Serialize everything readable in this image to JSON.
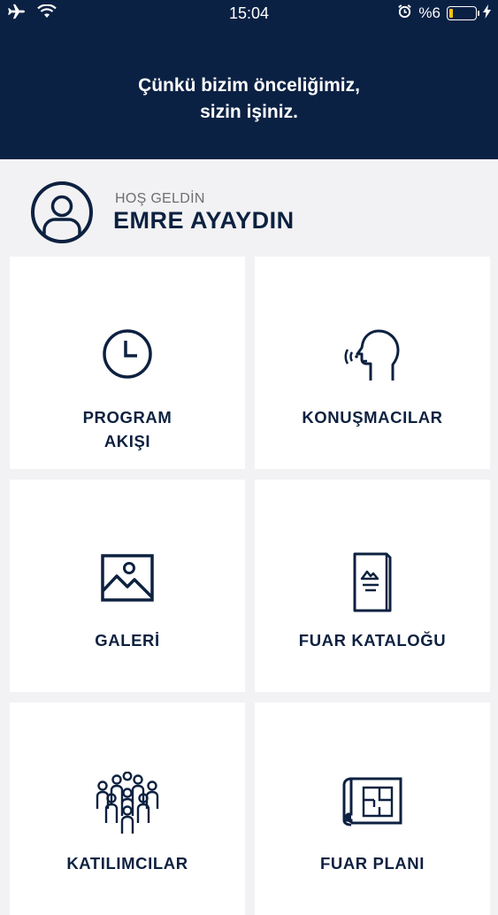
{
  "status_bar": {
    "time": "15:04",
    "battery_text": "%6",
    "battery_level": 0.06,
    "battery_color": "#f1c40f"
  },
  "header": {
    "tagline_line1": "Çünkü bizim önceliğimiz,",
    "tagline_line2": "sizin işiniz.",
    "background": "#0b2144"
  },
  "welcome": {
    "label": "HOŞ GELDİN",
    "name": "EMRE AYAYDIN"
  },
  "tiles": [
    {
      "icon": "clock-icon",
      "label_line1": "PROGRAM",
      "label_line2": "AKIŞI"
    },
    {
      "icon": "speaker-head-icon",
      "label_line1": "KONUŞMACILAR"
    },
    {
      "icon": "image-icon",
      "label_line1": "GALERİ"
    },
    {
      "icon": "catalog-icon",
      "label_line1": "FUAR KATALOĞU"
    },
    {
      "icon": "people-group-icon",
      "label_line1": "KATILIMCILAR"
    },
    {
      "icon": "floor-plan-icon",
      "label_line1": "FUAR PLANI"
    }
  ],
  "colors": {
    "accent": "#0b2144",
    "page_background": "#f2f2f4",
    "tile_background": "#ffffff"
  }
}
